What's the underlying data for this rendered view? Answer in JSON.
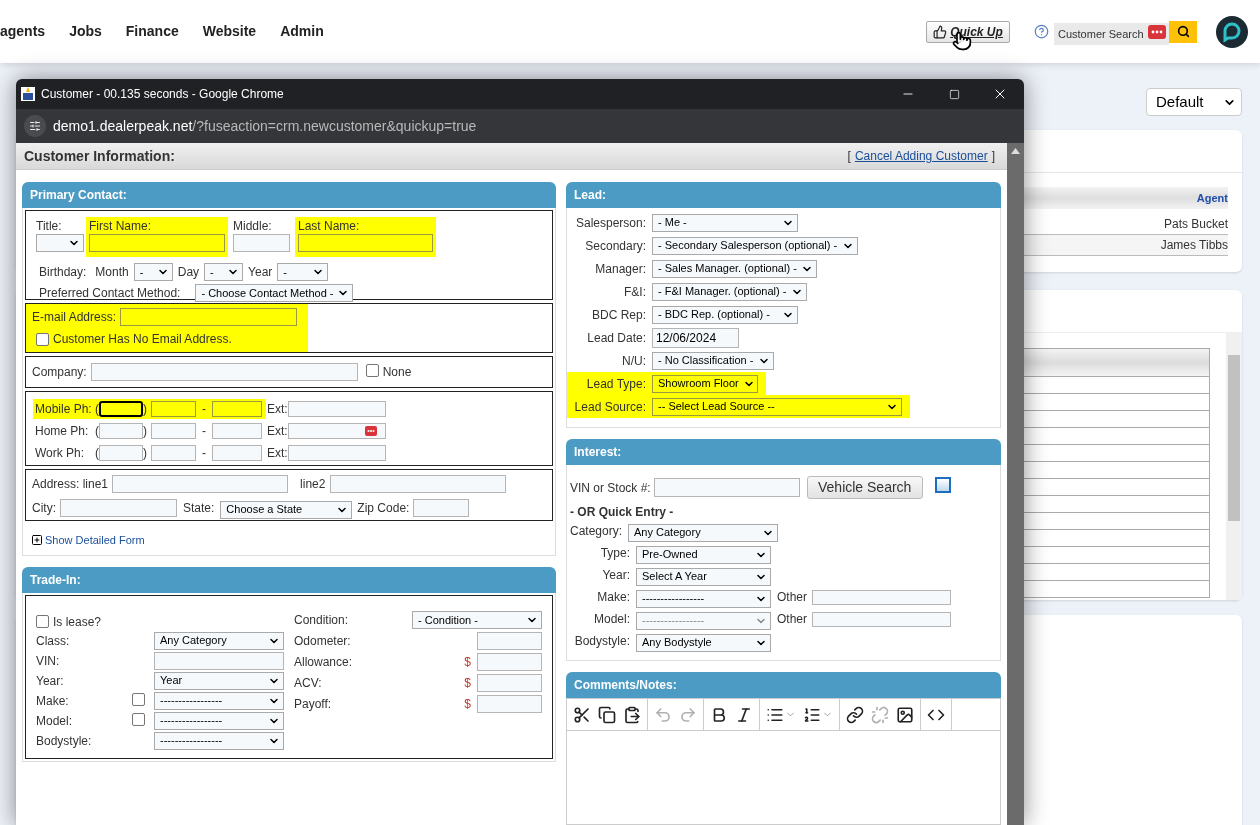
{
  "nav": {
    "items": [
      "agents",
      "Jobs",
      "Finance",
      "Website",
      "Admin"
    ],
    "quick_up": "Quick Up",
    "customer_search": {
      "placeholder": "Customer Search"
    }
  },
  "background": {
    "view_select": "Default",
    "agents_table": {
      "column": "Agent",
      "rows": [
        "Pats Bucket",
        "James Tibbs"
      ]
    }
  },
  "popup": {
    "title": "Customer - 00.135 seconds - Google Chrome",
    "url_host": "demo1.dealerpeak.net",
    "url_path": "/?fuseaction=crm.newcustomer&quickup=true",
    "heading": "Customer Information:",
    "cancel": {
      "open": "[",
      "label": "Cancel Adding Customer",
      "close": "]"
    },
    "primary_contact": {
      "title": "Primary Contact:",
      "name_fields": [
        {
          "label": "Title:",
          "kind": "select",
          "highlighted": false
        },
        {
          "label": "First Name:",
          "kind": "input",
          "highlighted": true
        },
        {
          "label": "Middle:",
          "kind": "input",
          "highlighted": false
        },
        {
          "label": "Last Name:",
          "kind": "input",
          "highlighted": true
        }
      ],
      "birthday": {
        "label": "Birthday:",
        "parts": [
          {
            "label": "Month",
            "value": "-"
          },
          {
            "label": "Day",
            "value": "-"
          },
          {
            "label": "Year",
            "value": "-"
          }
        ]
      },
      "contact_method": {
        "label": "Preferred Contact Method:",
        "value": "- Choose Contact Method -"
      },
      "email": {
        "label": "E-mail Address:",
        "highlighted": true,
        "no_email": {
          "label": "Customer Has No Email Address.",
          "checked": false
        }
      },
      "company": {
        "label": "Company:",
        "none": {
          "label": "None",
          "checked": false
        }
      },
      "phones": [
        {
          "label": "Mobile Ph:",
          "open": "(",
          "close": ")",
          "dash": "-",
          "ext": "Ext:",
          "highlighted": true,
          "focused": true,
          "autofill_icon": false
        },
        {
          "label": "Home Ph:",
          "open": "(",
          "close": ")",
          "dash": "-",
          "ext": "Ext:",
          "highlighted": false,
          "focused": false,
          "autofill_icon": true
        },
        {
          "label": "Work Ph:",
          "open": "(",
          "close": ")",
          "dash": "-",
          "ext": "Ext:",
          "highlighted": false,
          "focused": false,
          "autofill_icon": false
        }
      ],
      "address": {
        "line1_label": "Address: line1",
        "line2_label": "line2",
        "city_label": "City:",
        "state_label": "State:",
        "state_value": "Choose a State",
        "zip_label": "Zip Code:"
      },
      "detailed_form": {
        "label": "Show Detailed Form",
        "expanded": false
      }
    },
    "trade_in": {
      "title": "Trade-In:",
      "lease": {
        "label": "Is lease?",
        "checked": false
      },
      "left_rows": [
        {
          "label": "Class:",
          "kind": "select",
          "value": "Any Category"
        },
        {
          "label": "VIN:",
          "kind": "input"
        },
        {
          "label": "Year:",
          "kind": "select",
          "value": "Year"
        },
        {
          "label": "Make:",
          "kind": "select",
          "value": "-----------------",
          "checked": false
        },
        {
          "label": "Model:",
          "kind": "select",
          "value": "-----------------",
          "checked": false
        },
        {
          "label": "Bodystyle:",
          "kind": "select",
          "value": "-----------------"
        }
      ],
      "right_rows": [
        {
          "label": "Condition:",
          "kind": "select",
          "value": "- Condition -"
        },
        {
          "label": "Odometer:",
          "kind": "input"
        },
        {
          "label": "Allowance:",
          "kind": "input",
          "currency": "$"
        },
        {
          "label": "ACV:",
          "kind": "input",
          "currency": "$"
        },
        {
          "label": "Payoff:",
          "kind": "input",
          "currency": "$"
        }
      ]
    },
    "lead": {
      "title": "Lead:",
      "rows": [
        {
          "label": "Salesperson:",
          "kind": "select",
          "value": "- Me -",
          "highlighted": false
        },
        {
          "label": "Secondary:",
          "kind": "select",
          "value": "- Secondary Salesperson (optional) -",
          "highlighted": false
        },
        {
          "label": "Manager:",
          "kind": "select",
          "value": "- Sales Manager. (optional) -",
          "highlighted": false
        },
        {
          "label": "F&I:",
          "kind": "select",
          "value": "- F&I Manager. (optional) -",
          "highlighted": false
        },
        {
          "label": "BDC Rep:",
          "kind": "select",
          "value": "- BDC Rep. (optional) -",
          "highlighted": false
        },
        {
          "label": "Lead Date:",
          "kind": "input",
          "value": "12/06/2024",
          "highlighted": false
        },
        {
          "label": "N/U:",
          "kind": "select",
          "value": "- No Classification -",
          "highlighted": false
        },
        {
          "label": "Lead Type:",
          "kind": "select",
          "value": "Showroom Floor",
          "highlighted": true
        },
        {
          "label": "Lead Source:",
          "kind": "select",
          "value": "-- Select Lead Source --",
          "highlighted": true
        }
      ]
    },
    "interest": {
      "title": "Interest:",
      "vin_label": "VIN or Stock #:",
      "search_button": "Vehicle Search",
      "quick_entry": "- OR Quick Entry -",
      "rows": [
        {
          "label": "Category:",
          "value": "Any Category",
          "disabled": false
        },
        {
          "label": "Type:",
          "value": "Pre-Owned",
          "disabled": false
        },
        {
          "label": "Year:",
          "value": "Select A Year",
          "disabled": false
        },
        {
          "label": "Make:",
          "value": "-----------------",
          "disabled": false,
          "other": "Other"
        },
        {
          "label": "Model:",
          "value": "-----------------",
          "disabled": true,
          "other": "Other"
        },
        {
          "label": "Bodystyle:",
          "value": "Any Bodystyle",
          "disabled": false
        }
      ]
    },
    "comments": {
      "title": "Comments/Notes:",
      "toolbar": [
        [
          {
            "kind": "cut",
            "disabled": false
          },
          {
            "kind": "copy",
            "disabled": false
          },
          {
            "kind": "paste",
            "disabled": false
          }
        ],
        [
          {
            "kind": "undo",
            "disabled": true
          },
          {
            "kind": "redo",
            "disabled": true
          }
        ],
        [
          {
            "kind": "bold",
            "disabled": false
          },
          {
            "kind": "italic",
            "disabled": false
          }
        ],
        [
          {
            "kind": "bullets",
            "disabled": false,
            "menu": true
          },
          {
            "kind": "numbers",
            "disabled": false,
            "menu": true
          }
        ],
        [
          {
            "kind": "link",
            "disabled": false
          },
          {
            "kind": "unlink",
            "disabled": true
          },
          {
            "kind": "image",
            "disabled": false
          }
        ],
        [
          {
            "kind": "code",
            "disabled": false
          }
        ]
      ]
    }
  }
}
